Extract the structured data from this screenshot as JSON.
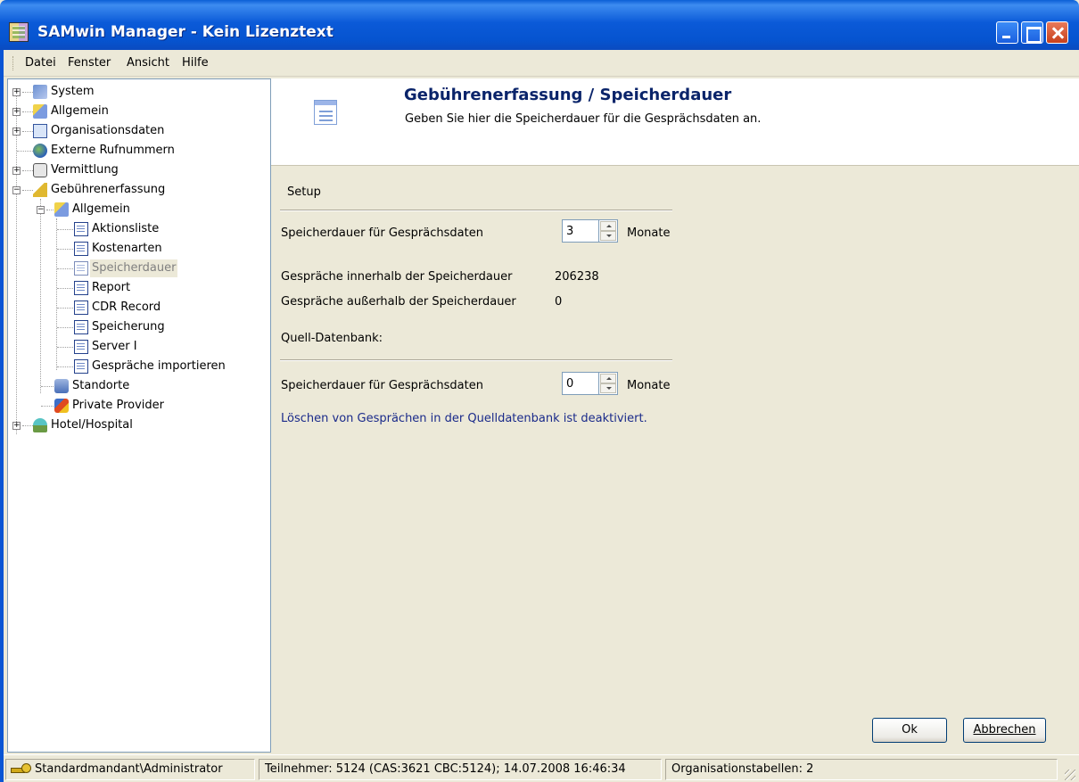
{
  "window": {
    "title": "SAMwin Manager - Kein Lizenztext"
  },
  "menu": [
    "Datei",
    "Fenster",
    "Ansicht",
    "Hilfe"
  ],
  "tree": [
    {
      "label": "System",
      "icon": "system-icon"
    },
    {
      "label": "Allgemein",
      "icon": "wrench-icon"
    },
    {
      "label": "Organisationsdaten",
      "icon": "book-icon"
    },
    {
      "label": "Externe Rufnummern",
      "icon": "globe-icon"
    },
    {
      "label": "Vermittlung",
      "icon": "phone-icon"
    },
    {
      "label": "Gebührenerfassung",
      "icon": "billing-icon"
    },
    {
      "label": "Allgemein",
      "icon": "wrench-icon"
    },
    {
      "label": "Aktionsliste",
      "icon": "form-icon"
    },
    {
      "label": "Kostenarten",
      "icon": "form-icon"
    },
    {
      "label": "Speicherdauer",
      "icon": "form-icon"
    },
    {
      "label": "Report",
      "icon": "form-icon"
    },
    {
      "label": "CDR Record",
      "icon": "form-icon"
    },
    {
      "label": "Speicherung",
      "icon": "form-icon"
    },
    {
      "label": "Server I",
      "icon": "form-icon"
    },
    {
      "label": "Gespräche importieren",
      "icon": "form-icon"
    },
    {
      "label": "Standorte",
      "icon": "location-icon"
    },
    {
      "label": "Private Provider",
      "icon": "provider-icon"
    },
    {
      "label": "Hotel/Hospital",
      "icon": "hotel-icon"
    }
  ],
  "header": {
    "title": "Gebührenerfassung / Speicherdauer",
    "subtitle": "Geben Sie hier die Speicherdauer für die Gesprächsdaten an."
  },
  "setup": {
    "section_label": "Setup",
    "retention_label": "Speicherdauer für Gesprächsdaten",
    "retention_value": "3",
    "retention_unit": "Monate",
    "inside_label": "Gespräche innerhalb der Speicherdauer",
    "inside_value": "206238",
    "outside_label": "Gespräche außerhalb der Speicherdauer",
    "outside_value": "0"
  },
  "source": {
    "section_label": "Quell-Datenbank:",
    "retention_label": "Speicherdauer für Gesprächsdaten",
    "retention_value": "0",
    "retention_unit": "Monate",
    "info": "Löschen von Gesprächen in der Quelldatenbank ist deaktiviert."
  },
  "buttons": {
    "ok": "Ok",
    "cancel": "Abbrechen"
  },
  "status": {
    "user": "Standardmandant\\Administrator",
    "participants": "Teilnehmer: 5124 (CAS:3621 CBC:5124); 14.07.2008 16:46:34",
    "tables": "Organisationstabellen: 2"
  },
  "colors": {
    "titlebar": "#0a5fd6",
    "header_title": "#0a246a",
    "info_text": "#1a2a8a",
    "panel_bg": "#ece9d8"
  }
}
